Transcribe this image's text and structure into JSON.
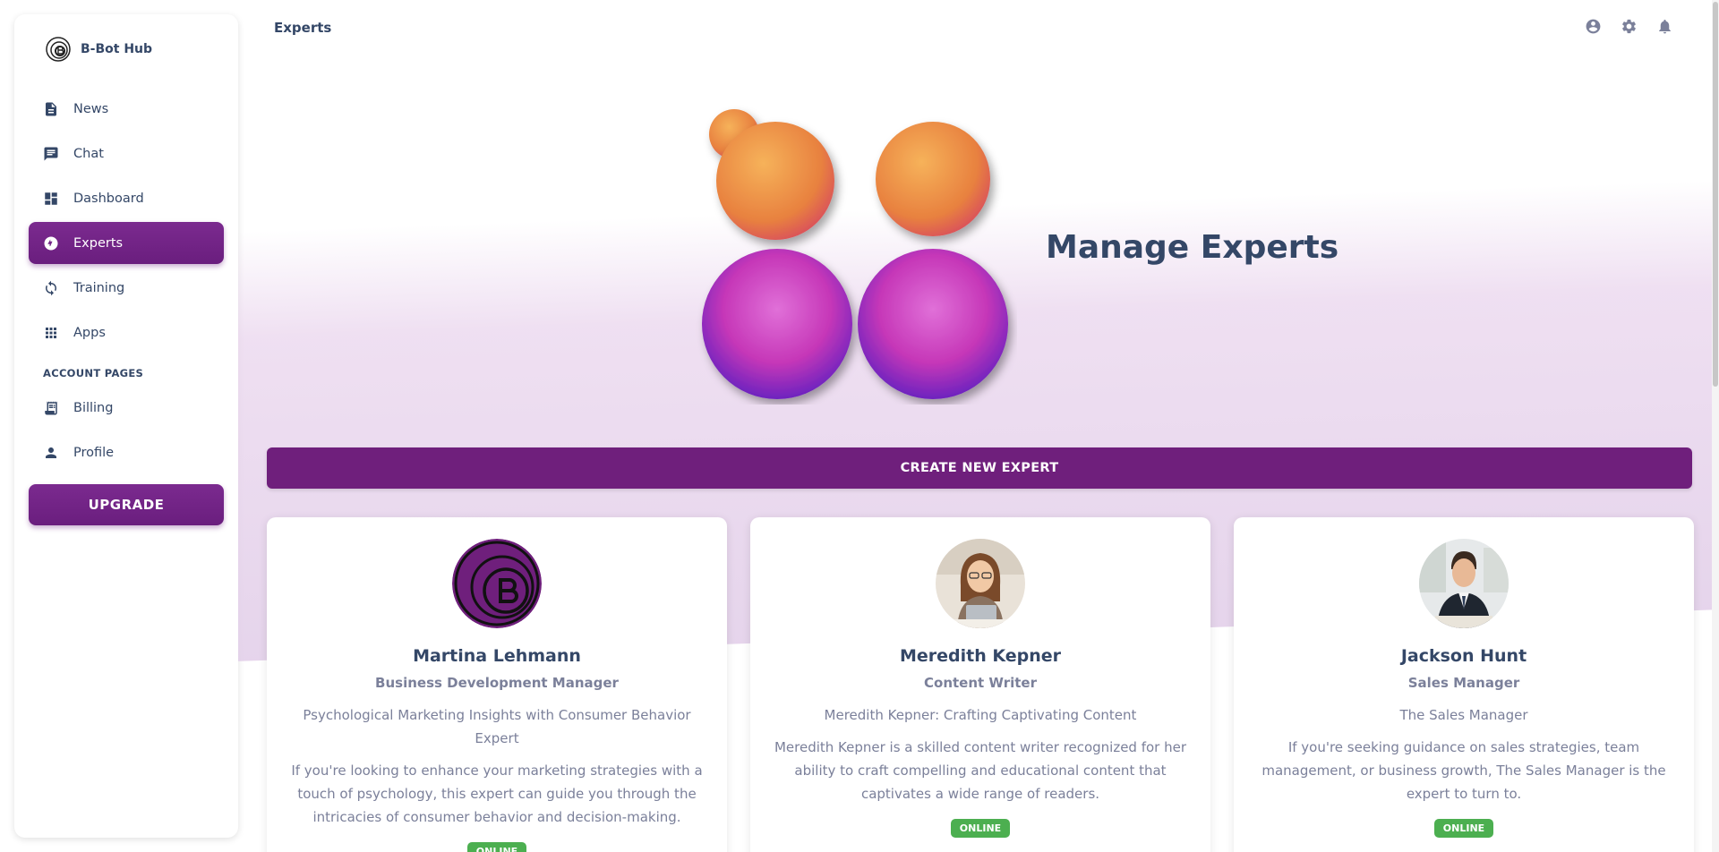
{
  "brand": {
    "name": "B-Bot Hub"
  },
  "sidebar": {
    "items": [
      {
        "label": "News",
        "icon": "newspaper-icon"
      },
      {
        "label": "Chat",
        "icon": "chat-icon"
      },
      {
        "label": "Dashboard",
        "icon": "dashboard-icon"
      },
      {
        "label": "Experts",
        "icon": "expert-icon",
        "active": true
      },
      {
        "label": "Training",
        "icon": "training-icon"
      },
      {
        "label": "Apps",
        "icon": "apps-grid-icon"
      }
    ],
    "section_title": "ACCOUNT PAGES",
    "account_items": [
      {
        "label": "Billing",
        "icon": "receipt-icon"
      },
      {
        "label": "Profile",
        "icon": "person-icon"
      }
    ],
    "upgrade_label": "UPGRADE"
  },
  "topbar": {
    "title": "Experts",
    "icons": [
      "account-circle-icon",
      "settings-gear-icon",
      "notifications-bell-icon"
    ]
  },
  "hero": {
    "title": "Manage Experts"
  },
  "create_button": {
    "label": "CREATE NEW EXPERT"
  },
  "experts": [
    {
      "name": "Martina Lehmann",
      "role": "Business Development Manager",
      "tagline": "Psychological Marketing Insights with Consumer Behavior Expert",
      "description": "If you're looking to enhance your marketing strategies with a touch of psychology, this expert can guide you through the intricacies of consumer behavior and decision-making.",
      "status": "ONLINE"
    },
    {
      "name": "Meredith Kepner",
      "role": "Content Writer",
      "tagline": "Meredith Kepner: Crafting Captivating Content",
      "description": "Meredith Kepner is a skilled content writer recognized for her ability to craft compelling and educational content that captivates a wide range of readers.",
      "status": "ONLINE"
    },
    {
      "name": "Jackson Hunt",
      "role": "Sales Manager",
      "tagline": "The Sales Manager",
      "description": "If you're seeking guidance on sales strategies, team management, or business growth, The Sales Manager is the expert to turn to.",
      "status": "ONLINE"
    }
  ],
  "colors": {
    "accent": "#6f1f7c",
    "text": "#344767",
    "muted": "#7b809a",
    "online": "#4caf50"
  }
}
